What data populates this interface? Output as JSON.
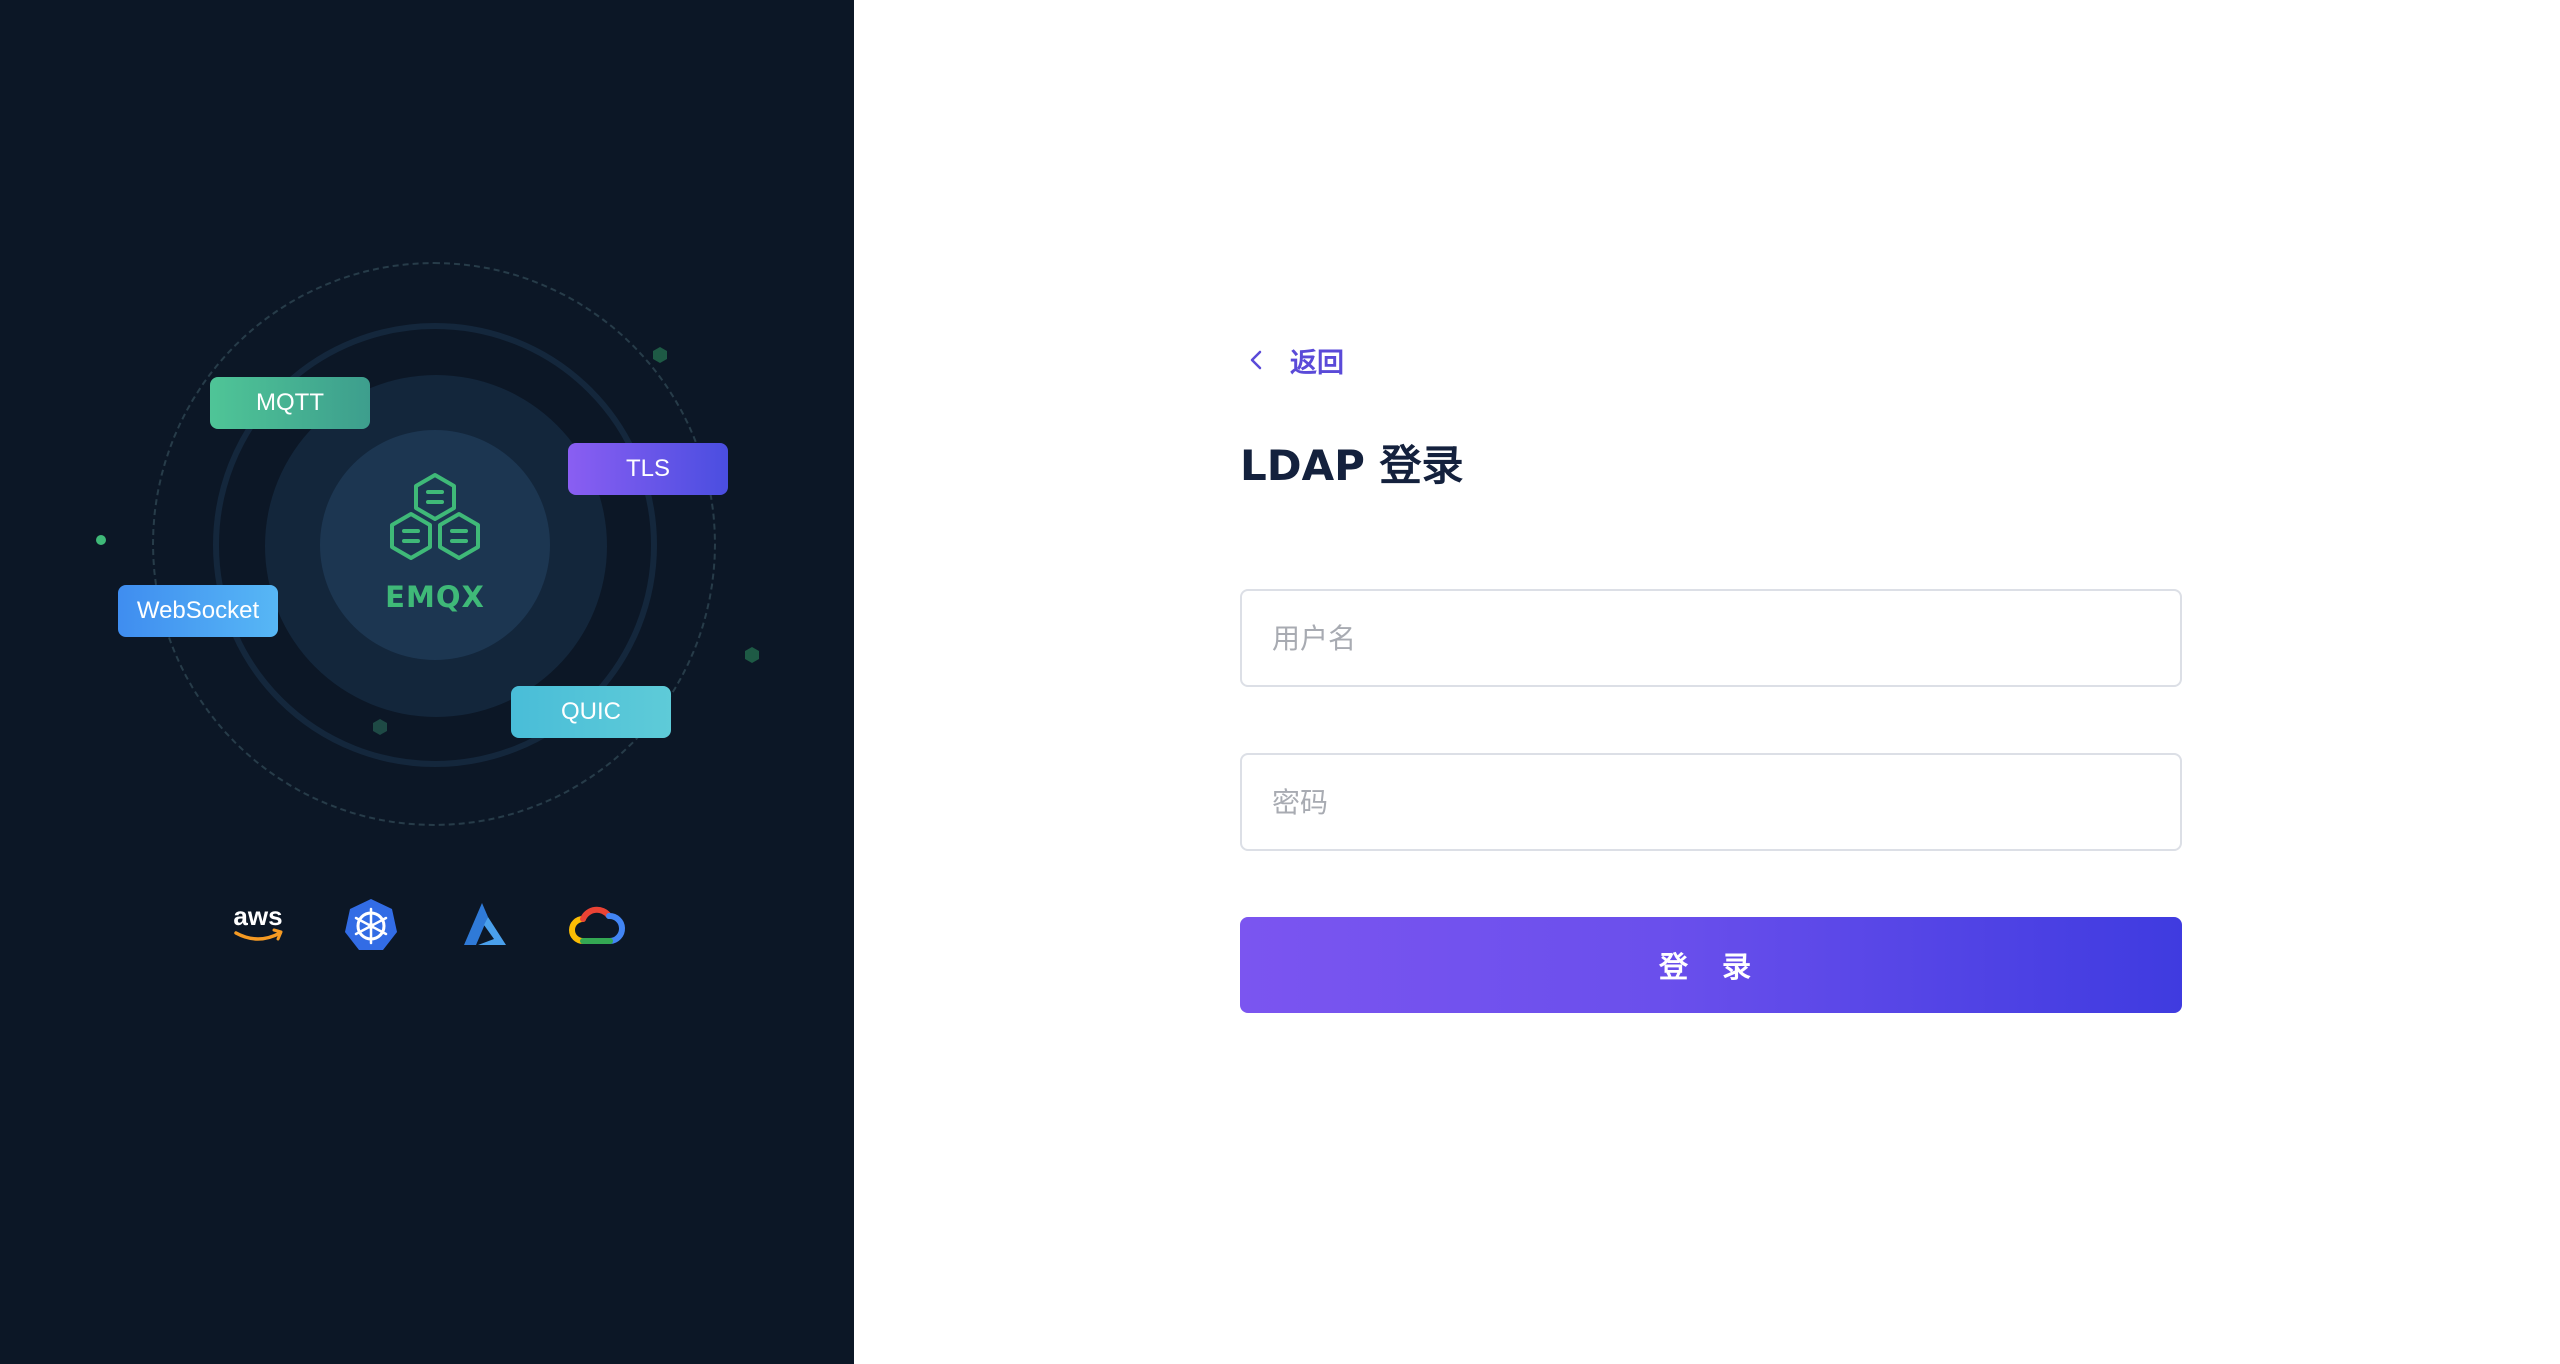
{
  "hero": {
    "core_label": "EMQX",
    "protocols": {
      "mqtt": "MQTT",
      "tls": "TLS",
      "websocket": "WebSocket",
      "quic": "QUIC"
    },
    "cloud_logos": {
      "aws": "aws",
      "kubernetes": "kubernetes-icon",
      "azure": "azure-icon",
      "gcp": "google-cloud-icon"
    }
  },
  "login": {
    "back_label": "返回",
    "title": "LDAP 登录",
    "username_placeholder": "用户名",
    "password_placeholder": "密码",
    "submit_label": "登 录"
  },
  "colors": {
    "left_bg": "#0c1726",
    "accent": "#5a4ad8",
    "emqx_green": "#3fb978",
    "title": "#14213d"
  }
}
